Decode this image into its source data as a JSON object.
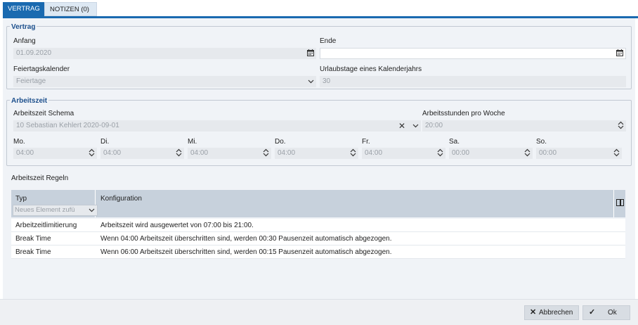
{
  "tabs": [
    {
      "label": "VERTRAG",
      "active": true
    },
    {
      "label": "NOTIZEN (0)",
      "active": false
    }
  ],
  "vertrag": {
    "legend": "Vertrag",
    "anfang_label": "Anfang",
    "anfang_value": "01.09.2020",
    "ende_label": "Ende",
    "ende_value": "",
    "feiertag_label": "Feiertagskalender",
    "feiertag_value": "Feiertage",
    "urlaub_label": "Urlaubstage eines Kalenderjahrs",
    "urlaub_value": "30"
  },
  "arbeitszeit": {
    "legend": "Arbeitszeit",
    "schema_label": "Arbeitszeit Schema",
    "schema_value": "10 Sebastian Kehlert 2020-09-01",
    "stunden_label": "Arbeitsstunden pro Woche",
    "stunden_value": "20:00",
    "days": [
      {
        "label": "Mo.",
        "value": "04:00"
      },
      {
        "label": "Di.",
        "value": "04:00"
      },
      {
        "label": "Mi.",
        "value": "04:00"
      },
      {
        "label": "Do.",
        "value": "04:00"
      },
      {
        "label": "Fr.",
        "value": "04:00"
      },
      {
        "label": "Sa.",
        "value": "00:00"
      },
      {
        "label": "So.",
        "value": "00:00"
      }
    ]
  },
  "regeln": {
    "title": "Arbeitszeit Regeln",
    "col_typ": "Typ",
    "col_konfiguration": "Konfiguration",
    "add_placeholder": "Neues Element zufü",
    "rows": [
      {
        "typ": "Arbeitzeitlimitierung",
        "konfiguration": "Arbeitszeit wird ausgewertet von 07:00 bis 21:00."
      },
      {
        "typ": "Break Time",
        "konfiguration": "Wenn 04:00 Arbeitszeit überschritten sind, werden 00:30 Pausenzeit automatisch abgezogen."
      },
      {
        "typ": "Break Time",
        "konfiguration": "Wenn 06:00 Arbeitszeit überschritten sind, werden 00:15 Pausenzeit automatisch abgezogen."
      }
    ]
  },
  "footer": {
    "cancel_label": "Abbrechen",
    "ok_label": "Ok"
  },
  "icons": {
    "calendar": "calendar-icon",
    "chevron": "chevron-down-icon",
    "clear": "clear-icon",
    "spinner": "spinner-icon",
    "columns": "columns-icon"
  },
  "colors": {
    "accent": "#1a6ab0",
    "legend": "#1c4f8c",
    "panel": "#f0f3f7",
    "grid_header": "#c7d1dc"
  }
}
